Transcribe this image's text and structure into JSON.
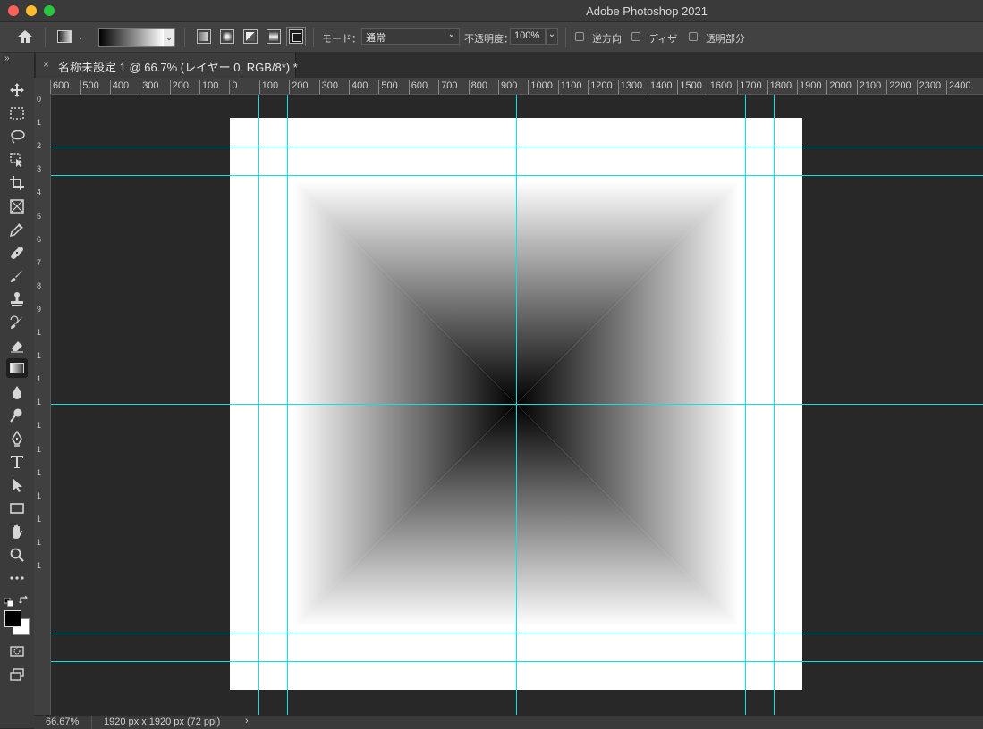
{
  "window": {
    "title": "Adobe Photoshop 2021"
  },
  "options_bar": {
    "mode_label": "モード：",
    "mode_value": "通常",
    "opacity_label": "不透明度：",
    "opacity_value": "100%",
    "reverse_label": "逆方向",
    "dither_label": "ディザ",
    "transparency_label": "透明部分",
    "gradient_types": [
      "linear",
      "radial",
      "angle",
      "reflected",
      "diamond"
    ],
    "active_gradient_type": "diamond"
  },
  "document_tab": {
    "title": "名称未設定 1 @ 66.7% (レイヤー 0, RGB/8*) *",
    "close": "×"
  },
  "panel_toggle": "»",
  "rulers": {
    "horizontal": [
      "600",
      "500",
      "400",
      "300",
      "200",
      "100",
      "0",
      "100",
      "200",
      "300",
      "400",
      "500",
      "600",
      "700",
      "800",
      "900",
      "1000",
      "1100",
      "1200",
      "1300",
      "1400",
      "1500",
      "1600",
      "1700",
      "1800",
      "1900",
      "2000",
      "2100",
      "2200",
      "2300",
      "2400"
    ],
    "vertical": [
      "0",
      "1",
      "2",
      "3",
      "4",
      "5",
      "6",
      "7",
      "8",
      "9",
      "1",
      "1",
      "1",
      "1",
      "1",
      "1",
      "1",
      "1",
      "1",
      "1",
      "1"
    ]
  },
  "canvas": {
    "gradient_type": "diamond",
    "start_color": "#000000",
    "end_color": "#ffffff",
    "guide_color": "#00e5e5"
  },
  "status": {
    "zoom": "66.67%",
    "doc_info": "1920 px x 1920 px (72 ppi)",
    "arrow": "›"
  },
  "tools": [
    "move-tool",
    "marquee-tool",
    "lasso-tool",
    "object-select-tool",
    "crop-tool",
    "frame-tool",
    "eyedropper-tool",
    "healing-brush-tool",
    "brush-tool",
    "clone-stamp-tool",
    "history-brush-tool",
    "eraser-tool",
    "gradient-tool",
    "blur-tool",
    "dodge-tool",
    "pen-tool",
    "type-tool",
    "path-selection-tool",
    "rectangle-tool",
    "hand-tool",
    "zoom-tool",
    "more-tools"
  ],
  "colors": {
    "foreground": "#000000",
    "background": "#ffffff"
  }
}
